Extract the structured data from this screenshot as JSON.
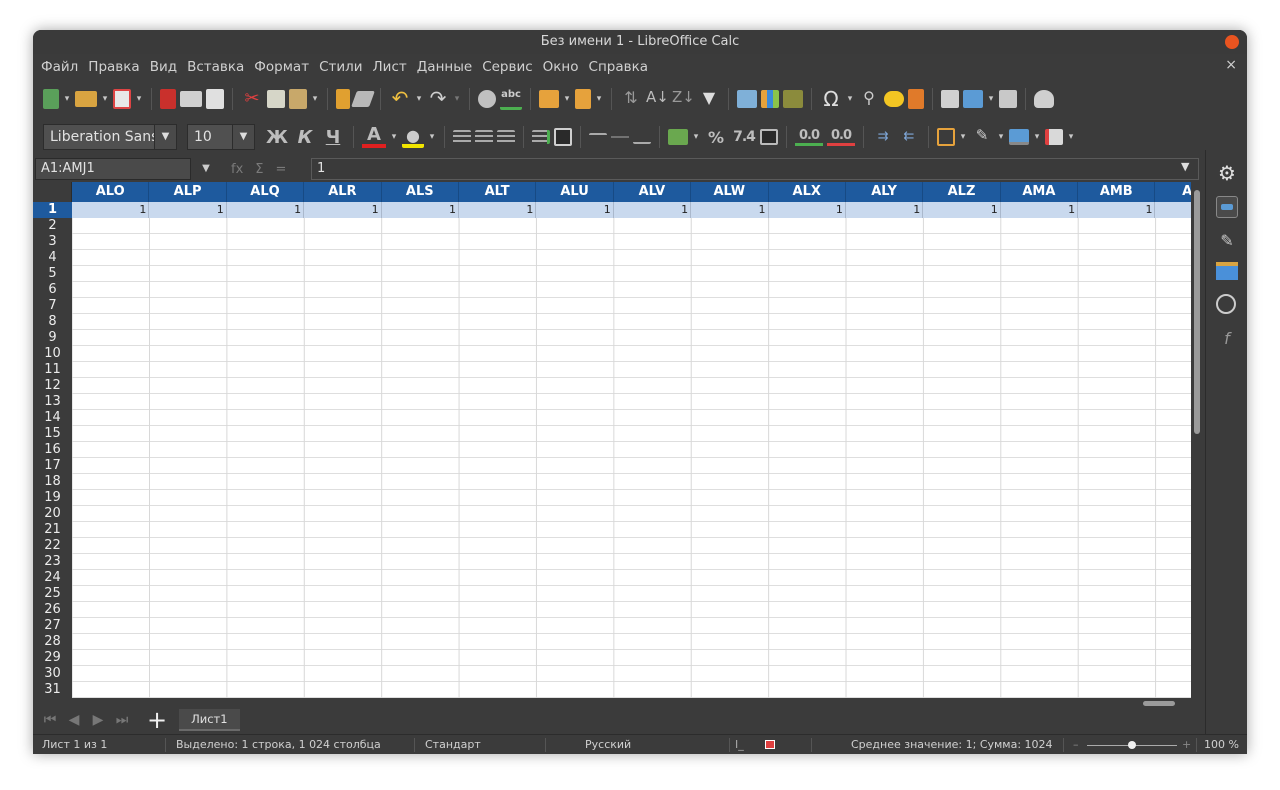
{
  "window": {
    "title": "Без имени 1 - LibreOffice Calc"
  },
  "menu": [
    "Файл",
    "Правка",
    "Вид",
    "Вставка",
    "Формат",
    "Стили",
    "Лист",
    "Данные",
    "Сервис",
    "Окно",
    "Справка"
  ],
  "menu_close": "×",
  "format": {
    "font_name": "Liberation Sans",
    "font_size": "10",
    "bold": "Ж",
    "italic": "К",
    "underline": "Ч",
    "font_color_letter": "A",
    "percent": "%",
    "number": "7.4",
    "add_decimal": "0.0",
    "remove_decimal": "0.0"
  },
  "formula": {
    "name_box": "A1:AMJ1",
    "input": "1",
    "fx": "fx",
    "sigma": "Σ",
    "equals": "="
  },
  "columns": [
    "ALO",
    "ALP",
    "ALQ",
    "ALR",
    "ALS",
    "ALT",
    "ALU",
    "ALV",
    "ALW",
    "ALX",
    "ALY",
    "ALZ",
    "AMA",
    "AMB",
    "AM"
  ],
  "rows": [
    "1",
    "2",
    "3",
    "4",
    "5",
    "6",
    "7",
    "8",
    "9",
    "10",
    "11",
    "12",
    "13",
    "14",
    "15",
    "16",
    "17",
    "18",
    "19",
    "20",
    "21",
    "22",
    "23",
    "24",
    "25",
    "26",
    "27",
    "28",
    "29",
    "30",
    "31"
  ],
  "row1_values": [
    "1",
    "1",
    "1",
    "1",
    "1",
    "1",
    "1",
    "1",
    "1",
    "1",
    "1",
    "1",
    "1",
    "1",
    ""
  ],
  "sheet_tab": "Лист1",
  "status": {
    "sheet": "Лист 1 из 1",
    "selection": "Выделено: 1 строка, 1 024 столбца",
    "style": "Стандарт",
    "language": "Русский",
    "summary": "Среднее значение: 1; Сумма: 1024",
    "zoom": "100 %",
    "zoom_minus": "–",
    "zoom_plus": "+"
  },
  "accent": "#1e5a9e"
}
